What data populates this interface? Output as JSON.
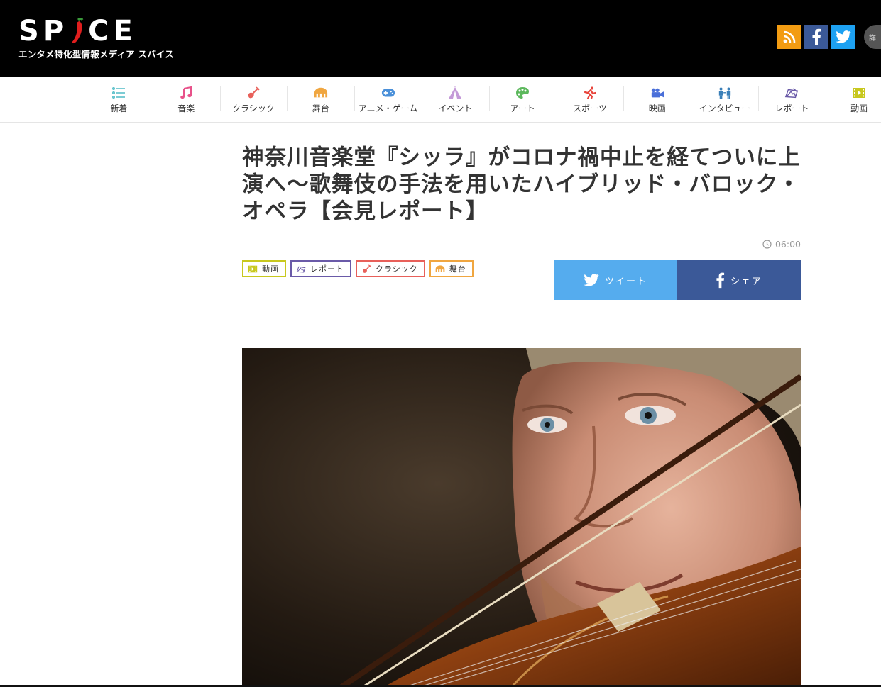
{
  "header": {
    "logo_text": "SPICE",
    "logo_tagline": "エンタメ特化型情報メディア スパイス",
    "social": [
      {
        "name": "rss",
        "color": "#f39c12"
      },
      {
        "name": "facebook",
        "color": "#3b5998"
      },
      {
        "name": "twitter",
        "color": "#1da1f2"
      }
    ],
    "more_label": "詳"
  },
  "nav": {
    "items": [
      {
        "label": "新着",
        "icon": "list-icon",
        "color": "#5bc0c9"
      },
      {
        "label": "音楽",
        "icon": "music-note-icon",
        "color": "#e8528a"
      },
      {
        "label": "クラシック",
        "icon": "violin-icon",
        "color": "#e8605a"
      },
      {
        "label": "舞台",
        "icon": "theater-icon",
        "color": "#f0a640"
      },
      {
        "label": "アニメ・ゲーム",
        "icon": "gamepad-icon",
        "color": "#4a90d9"
      },
      {
        "label": "イベント",
        "icon": "tent-icon",
        "color": "#c49ad8"
      },
      {
        "label": "アート",
        "icon": "palette-icon",
        "color": "#5cb85c"
      },
      {
        "label": "スポーツ",
        "icon": "runner-icon",
        "color": "#e8453c"
      },
      {
        "label": "映画",
        "icon": "camera-icon",
        "color": "#4a6fd9"
      },
      {
        "label": "インタビュー",
        "icon": "interview-icon",
        "color": "#3a7fb8"
      },
      {
        "label": "レポート",
        "icon": "report-icon",
        "color": "#6a5aa8"
      },
      {
        "label": "動画",
        "icon": "film-icon",
        "color": "#c8c81e"
      }
    ]
  },
  "article": {
    "title": "神奈川音楽堂『シッラ』がコロナ禍中止を経てついに上演へ〜歌舞伎の手法を用いたハイブリッド・バロック・オペラ【会見レポート】",
    "time": "06:00",
    "tags": [
      {
        "label": "動画",
        "icon": "film-icon",
        "color": "#c8c81e"
      },
      {
        "label": "レポート",
        "icon": "report-icon",
        "color": "#6a5aa8"
      },
      {
        "label": "クラシック",
        "icon": "violin-icon",
        "color": "#e8605a"
      },
      {
        "label": "舞台",
        "icon": "theater-icon",
        "color": "#f0a640"
      }
    ],
    "share": {
      "tweet_label": "ツイート",
      "facebook_label": "シェア",
      "tweet_color": "#55acee",
      "facebook_color": "#3b5998"
    },
    "photo_alt": "violinist-photo"
  }
}
